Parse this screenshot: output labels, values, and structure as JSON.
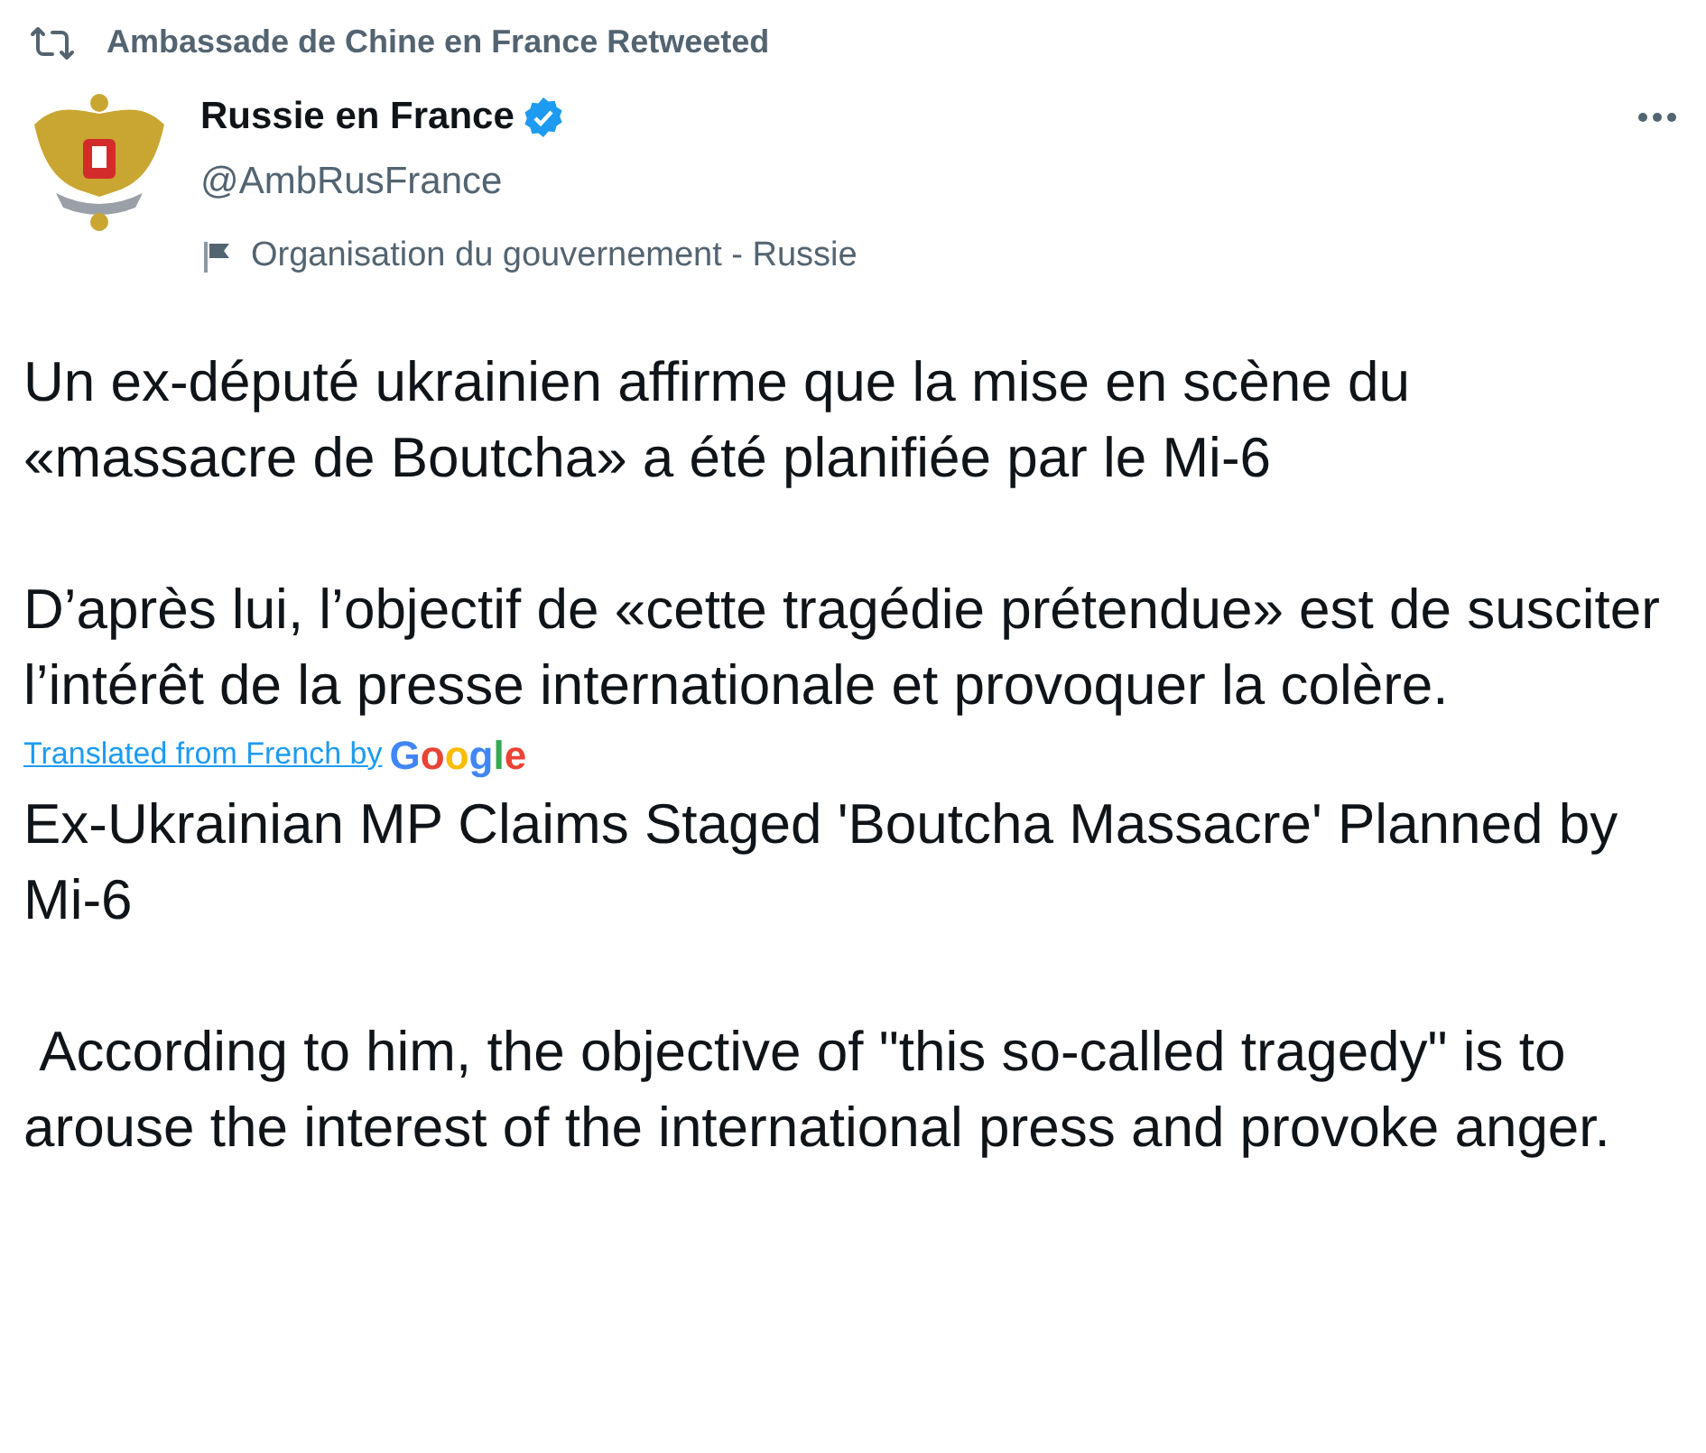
{
  "retweet": {
    "label": "Ambassade de Chine en France Retweeted"
  },
  "author": {
    "name": "Russie en France",
    "verified": true,
    "handle": "@AmbRusFrance",
    "label": "Organisation du gouvernement - Russie"
  },
  "original_text": [
    "Un ex-député ukrainien affirme que la mise en scène du «massacre de Boutcha» a été planifiée par le Mi-6",
    "D’après lui, l’objectif de «cette tragédie prétendue» est de susciter l’intérêt de la presse internationale et provoquer la colère."
  ],
  "translation": {
    "link": "Translated from French by",
    "provider": "Google"
  },
  "translated_text": [
    "Ex-Ukrainian MP Claims Staged 'Boutcha Massacre' Planned by Mi-6",
    " According to him, the objective of \"this so-called tragedy\" is to arouse the interest of the international press and provoke anger."
  ]
}
